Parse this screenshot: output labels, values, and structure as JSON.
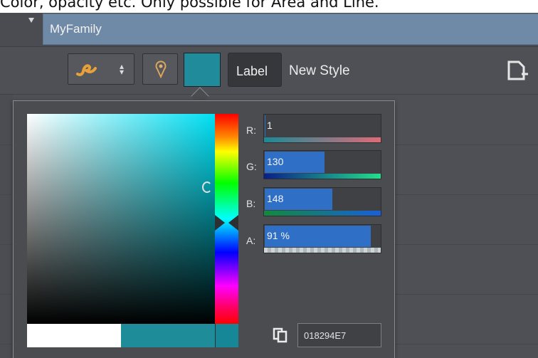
{
  "caption": {
    "text": "Color, opacity etc. Only possible for Area and Line."
  },
  "family": {
    "name": "MyFamily"
  },
  "style_row": {
    "label_button": "Label",
    "style_name": "New Style",
    "swatch_color": "#208c9b"
  },
  "color_picker": {
    "channels": {
      "r": {
        "label": "R:",
        "value": "1",
        "level": 0.004
      },
      "g": {
        "label": "G:",
        "value": "130",
        "level": 0.51
      },
      "b": {
        "label": "B:",
        "value": "148",
        "level": 0.58
      },
      "a": {
        "label": "A:",
        "value": "91 %",
        "level": 0.91
      }
    },
    "hex": "018294E7",
    "color": "#018294"
  },
  "icons": {
    "line_style": "line-style-icon",
    "location_pin": "location-pin-icon",
    "new_document": "new-document-icon",
    "copy": "copy-icon",
    "expand": "expand-triangle-icon"
  }
}
